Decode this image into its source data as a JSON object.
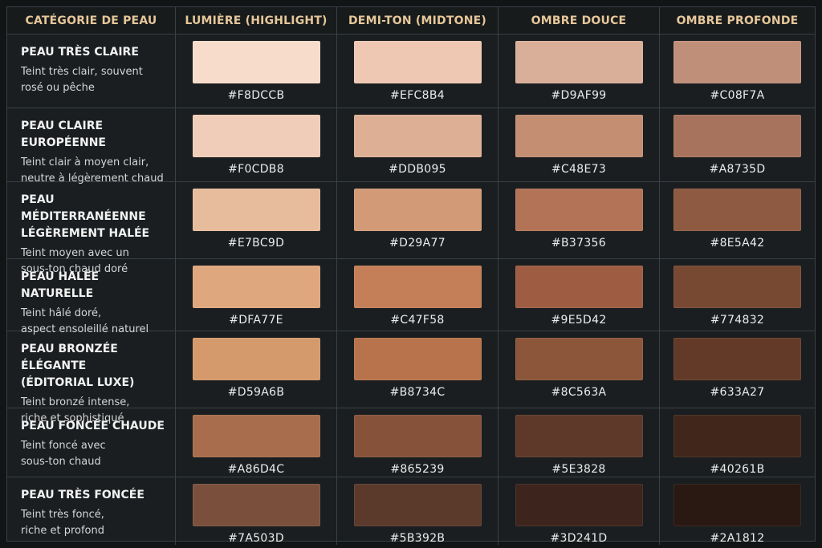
{
  "headers": [
    "CATÉGORIE DE PEAU",
    "LUMIÈRE (HIGHLIGHT)",
    "DEMI-TON (MIDTONE)",
    "OMBRE DOUCE",
    "OMBRE PROFONDE"
  ],
  "rows": [
    {
      "title": "PEAU TRÈS CLAIRE",
      "desc": "Teint très clair, souvent\nrosé ou pêche",
      "colors": [
        "#F8DCCB",
        "#EFC8B4",
        "#D9AF99",
        "#C08F7A"
      ]
    },
    {
      "title": "PEAU CLAIRE EUROPÉENNE",
      "desc": "Teint clair à moyen clair,\nneutre à légèrement chaud",
      "colors": [
        "#F0CDB8",
        "#DDB095",
        "#C48E73",
        "#A8735D"
      ]
    },
    {
      "title": "PEAU MÉDITERRANÉENNE\nLÉGÈREMENT HALÉE",
      "desc": "Teint moyen avec un\nsous-ton chaud doré",
      "colors": [
        "#E7BC9D",
        "#D29A77",
        "#B37356",
        "#8E5A42"
      ]
    },
    {
      "title": "PEAU HALÉE NATURELLE",
      "desc": "Teint hâlé doré,\naspect ensoleillé naturel",
      "colors": [
        "#DFA77E",
        "#C47F58",
        "#9E5D42",
        "#774832"
      ]
    },
    {
      "title": "PEAU BRONZÉE ÉLÉGANTE\n(ÉDITORIAL LUXE)",
      "desc": "Teint bronzé intense,\nriche et sophistiqué",
      "colors": [
        "#D59A6B",
        "#B8734C",
        "#8C563A",
        "#633A27"
      ]
    },
    {
      "title": "PEAU FONCÉE CHAUDE",
      "desc": "Teint foncé avec\nsous-ton chaud",
      "colors": [
        "#A86D4C",
        "#865239",
        "#5E3828",
        "#40261B"
      ]
    },
    {
      "title": "PEAU TRÈS FONCÉE",
      "desc": "Teint très foncé,\nriche et profond",
      "colors": [
        "#7A503D",
        "#5B392B",
        "#3D241D",
        "#2A1812"
      ]
    }
  ]
}
